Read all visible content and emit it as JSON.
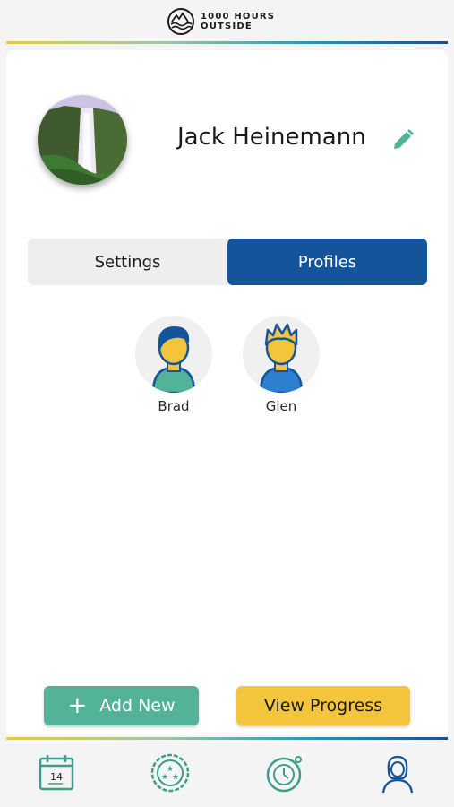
{
  "app": {
    "logo_line1": "1000 HOURS",
    "logo_line2": "OUTSIDE"
  },
  "profile": {
    "user_name": "Jack Heinemann",
    "avatar_image": "waterfall-photo"
  },
  "tabs": [
    {
      "label": "Settings",
      "active": false
    },
    {
      "label": "Profiles",
      "active": true
    }
  ],
  "children": [
    {
      "name": "Brad",
      "icon": "boy-avatar-icon"
    },
    {
      "name": "Glen",
      "icon": "boy-avatar-icon"
    }
  ],
  "actions": {
    "add_new_label": "Add New",
    "view_progress_label": "View Progress"
  },
  "nav": {
    "calendar_day": "14",
    "items": [
      "calendar-icon",
      "badges-icon",
      "timer-icon",
      "profile-icon"
    ]
  },
  "colors": {
    "primary": "#14549a",
    "accent_green": "#52b399",
    "accent_yellow": "#f2c53d",
    "icon_teal": "#3a9e8a"
  }
}
